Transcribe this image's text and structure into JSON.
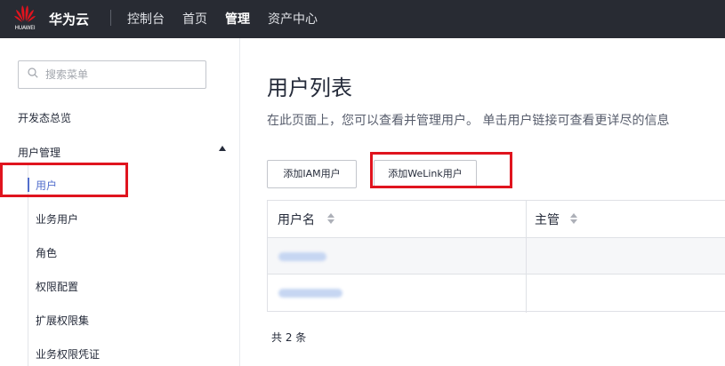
{
  "topbar": {
    "logo_text": "HUAWEI",
    "brand": "华为云",
    "nav": {
      "console": "控制台",
      "home": "首页",
      "manage": "管理",
      "resource": "资产中心"
    },
    "colors": {
      "background": "#282b33",
      "logo": "#e0141e"
    }
  },
  "sidebar": {
    "search": {
      "placeholder": "搜索菜单",
      "value": "",
      "icon": "search-icon"
    },
    "overview": "开发态总览",
    "user_management": {
      "label": "用户管理",
      "icon": "caret-up-icon",
      "expanded": true
    },
    "items": [
      {
        "label": "用户",
        "active": true
      },
      {
        "label": "业务用户"
      },
      {
        "label": "角色"
      },
      {
        "label": "权限配置"
      },
      {
        "label": "扩展权限集"
      },
      {
        "label": "业务权限凭证"
      }
    ],
    "colors": {
      "active": "#526ecc"
    }
  },
  "main": {
    "title": "用户列表",
    "description": "在此页面上，您可以查看并管理用户。 单击用户链接可查看更详尽的信息",
    "buttons": {
      "add_iam_user": "添加IAM用户",
      "add_welink_user": "添加WeLink用户"
    },
    "table": {
      "columns": [
        {
          "label": "用户名",
          "icon": "sort-icon"
        },
        {
          "label": "主管",
          "icon": "sort-icon"
        }
      ],
      "rows": 2
    },
    "total": "共 2 条"
  },
  "annotations": {
    "highlight_color": "#e0141e"
  }
}
